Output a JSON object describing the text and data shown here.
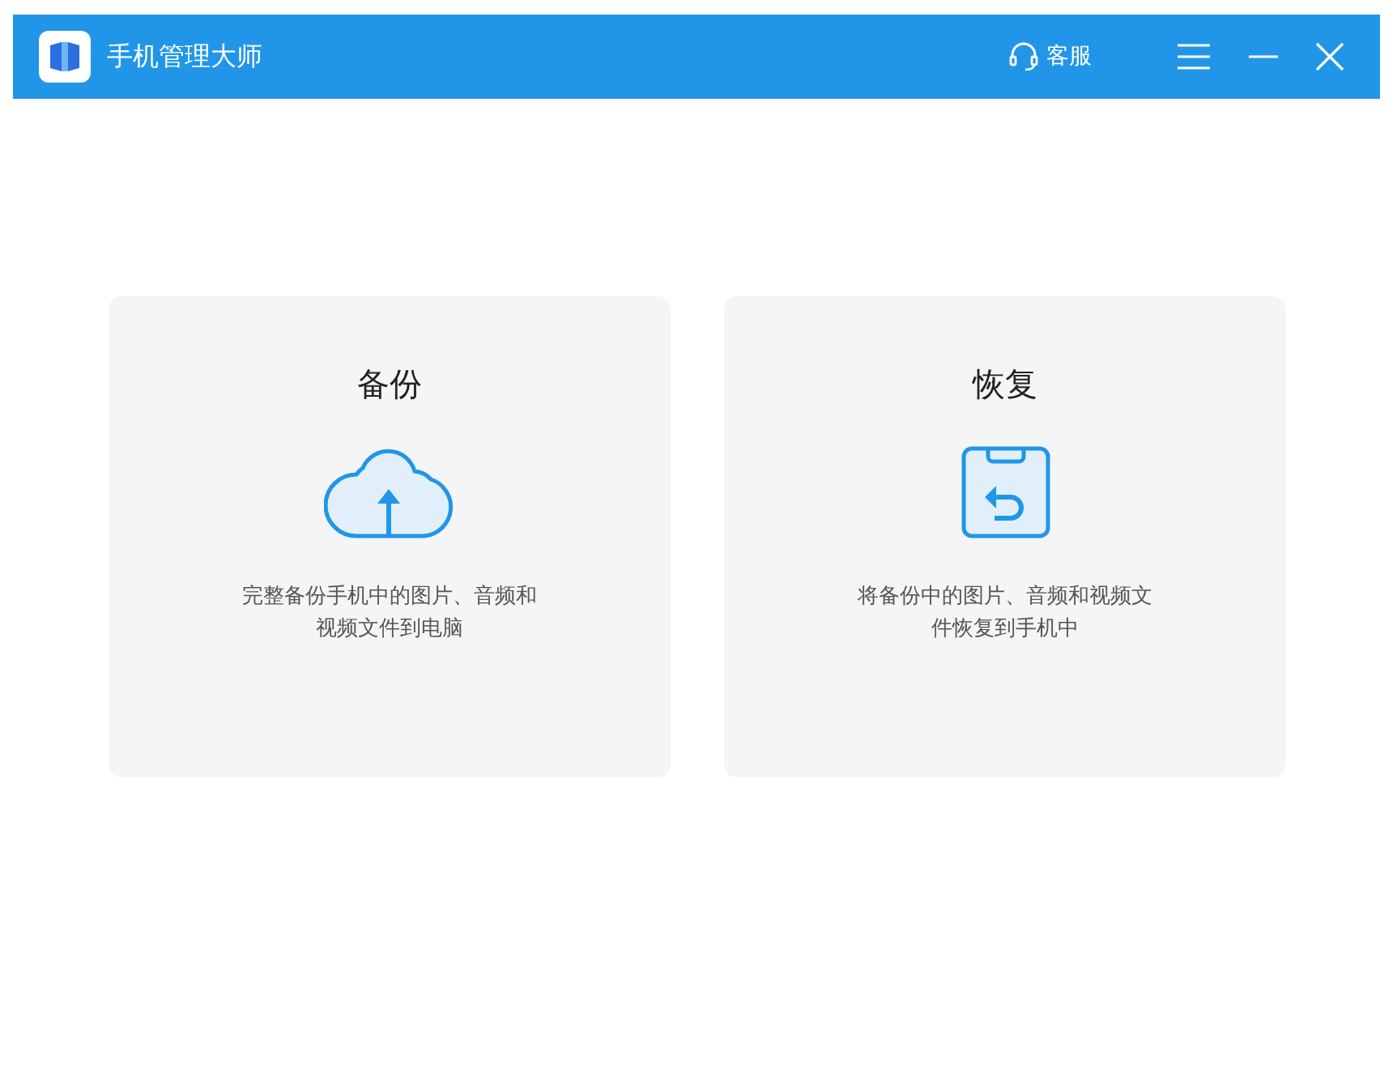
{
  "window": {
    "title": "手机管理大师",
    "support": "客服"
  },
  "cards": [
    {
      "kind": "backup",
      "title": "备份",
      "description": "完整备份手机中的图片、音频和视频文件到电脑"
    },
    {
      "kind": "restore",
      "title": "恢复",
      "description": "将备份中的图片、音频和视频文件恢复到手机中"
    }
  ]
}
